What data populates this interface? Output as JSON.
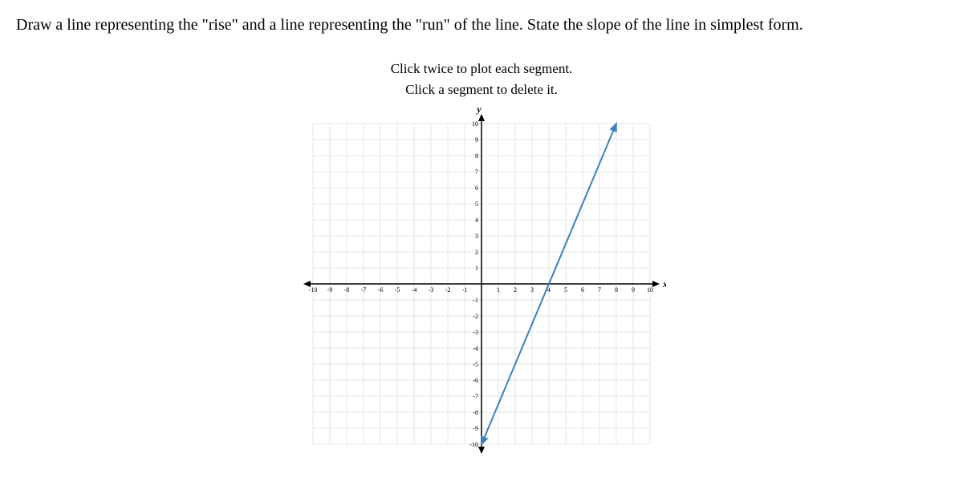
{
  "question": "Draw a line representing the \"rise\" and a line representing the \"run\" of the line. State the slope of the line in simplest form.",
  "instructions": {
    "line1": "Click twice to plot each segment.",
    "line2": "Click a segment to delete it."
  },
  "chart_data": {
    "type": "line",
    "title": "",
    "xlabel": "x",
    "ylabel": "y",
    "xlim": [
      -10,
      10
    ],
    "ylim": [
      -10,
      10
    ],
    "x_ticks": [
      -10,
      -9,
      -8,
      -7,
      -6,
      -5,
      -4,
      -3,
      -2,
      -1,
      1,
      2,
      3,
      4,
      5,
      6,
      7,
      8,
      9,
      10
    ],
    "y_ticks": [
      -10,
      -9,
      -8,
      -7,
      -6,
      -5,
      -4,
      -3,
      -2,
      -1,
      1,
      2,
      3,
      4,
      5,
      6,
      7,
      8,
      9,
      10
    ],
    "series": [
      {
        "name": "line",
        "color": "#3a80c4",
        "points": [
          {
            "x": 0,
            "y": -10
          },
          {
            "x": 8,
            "y": 10
          }
        ],
        "arrows": "both"
      }
    ],
    "grid": true
  }
}
